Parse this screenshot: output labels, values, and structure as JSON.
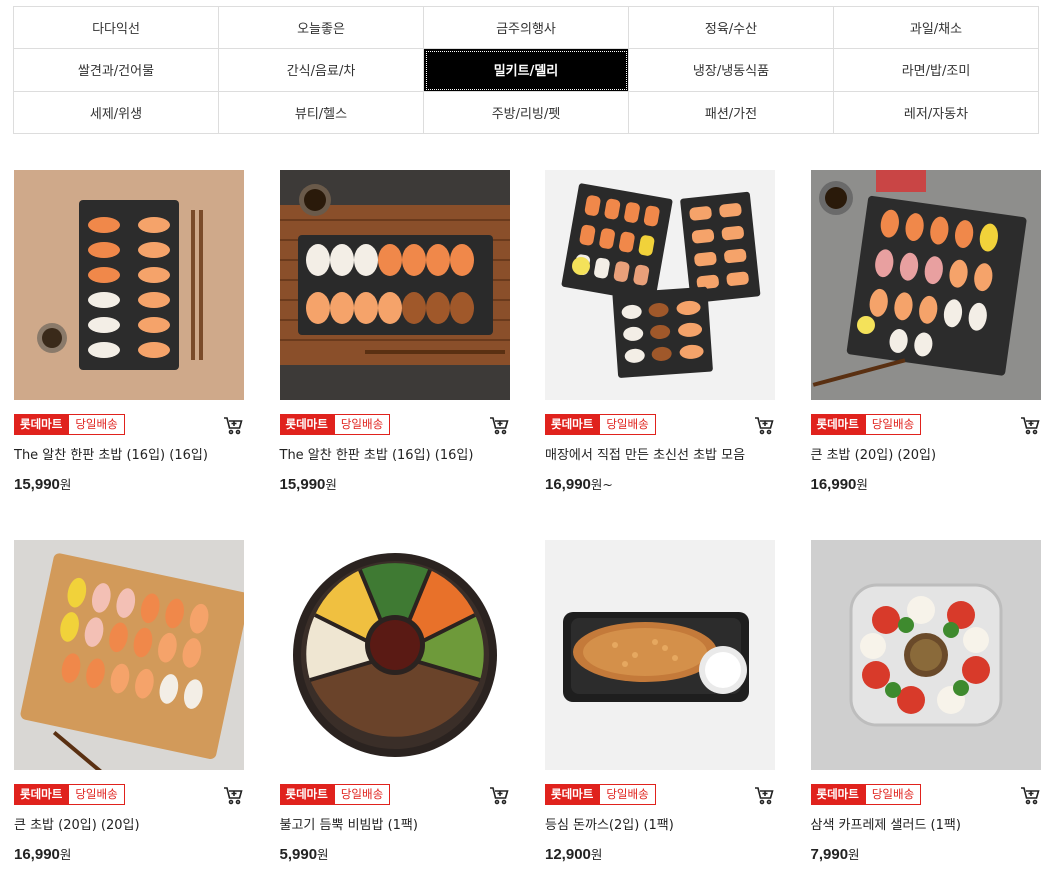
{
  "categories": [
    {
      "label": "다다익선"
    },
    {
      "label": "오늘좋은"
    },
    {
      "label": "금주의행사"
    },
    {
      "label": "정육/수산"
    },
    {
      "label": "과일/채소"
    },
    {
      "label": "쌀견과/건어물"
    },
    {
      "label": "간식/음료/차"
    },
    {
      "label": "밀키트/델리",
      "active": true
    },
    {
      "label": "냉장/냉동식품"
    },
    {
      "label": "라면/밥/조미"
    },
    {
      "label": "세제/위생"
    },
    {
      "label": "뷰티/헬스"
    },
    {
      "label": "주방/리빙/펫"
    },
    {
      "label": "패션/가전"
    },
    {
      "label": "레저/자동차"
    }
  ],
  "badges": {
    "mart": "롯데마트",
    "delivery": "당일배송"
  },
  "currency": "원",
  "products": [
    {
      "name": "The 알찬 한판 초밥 (16입) (16입)",
      "price": "15,990",
      "suffix": ""
    },
    {
      "name": "The 알찬 한판 초밥 (16입) (16입)",
      "price": "15,990",
      "suffix": ""
    },
    {
      "name": "매장에서 직접 만든 초신선 초밥 모음",
      "price": "16,990",
      "suffix": "~"
    },
    {
      "name": "큰 초밥 (20입) (20입)",
      "price": "16,990",
      "suffix": ""
    },
    {
      "name": "큰 초밥 (20입) (20입)",
      "price": "16,990",
      "suffix": ""
    },
    {
      "name": "불고기 듬뿍 비빔밥 (1팩)",
      "price": "5,990",
      "suffix": ""
    },
    {
      "name": "등심 돈까스(2입) (1팩)",
      "price": "12,900",
      "suffix": ""
    },
    {
      "name": "삼색 카프레제 샐러드 (1팩)",
      "price": "7,990",
      "suffix": ""
    }
  ]
}
